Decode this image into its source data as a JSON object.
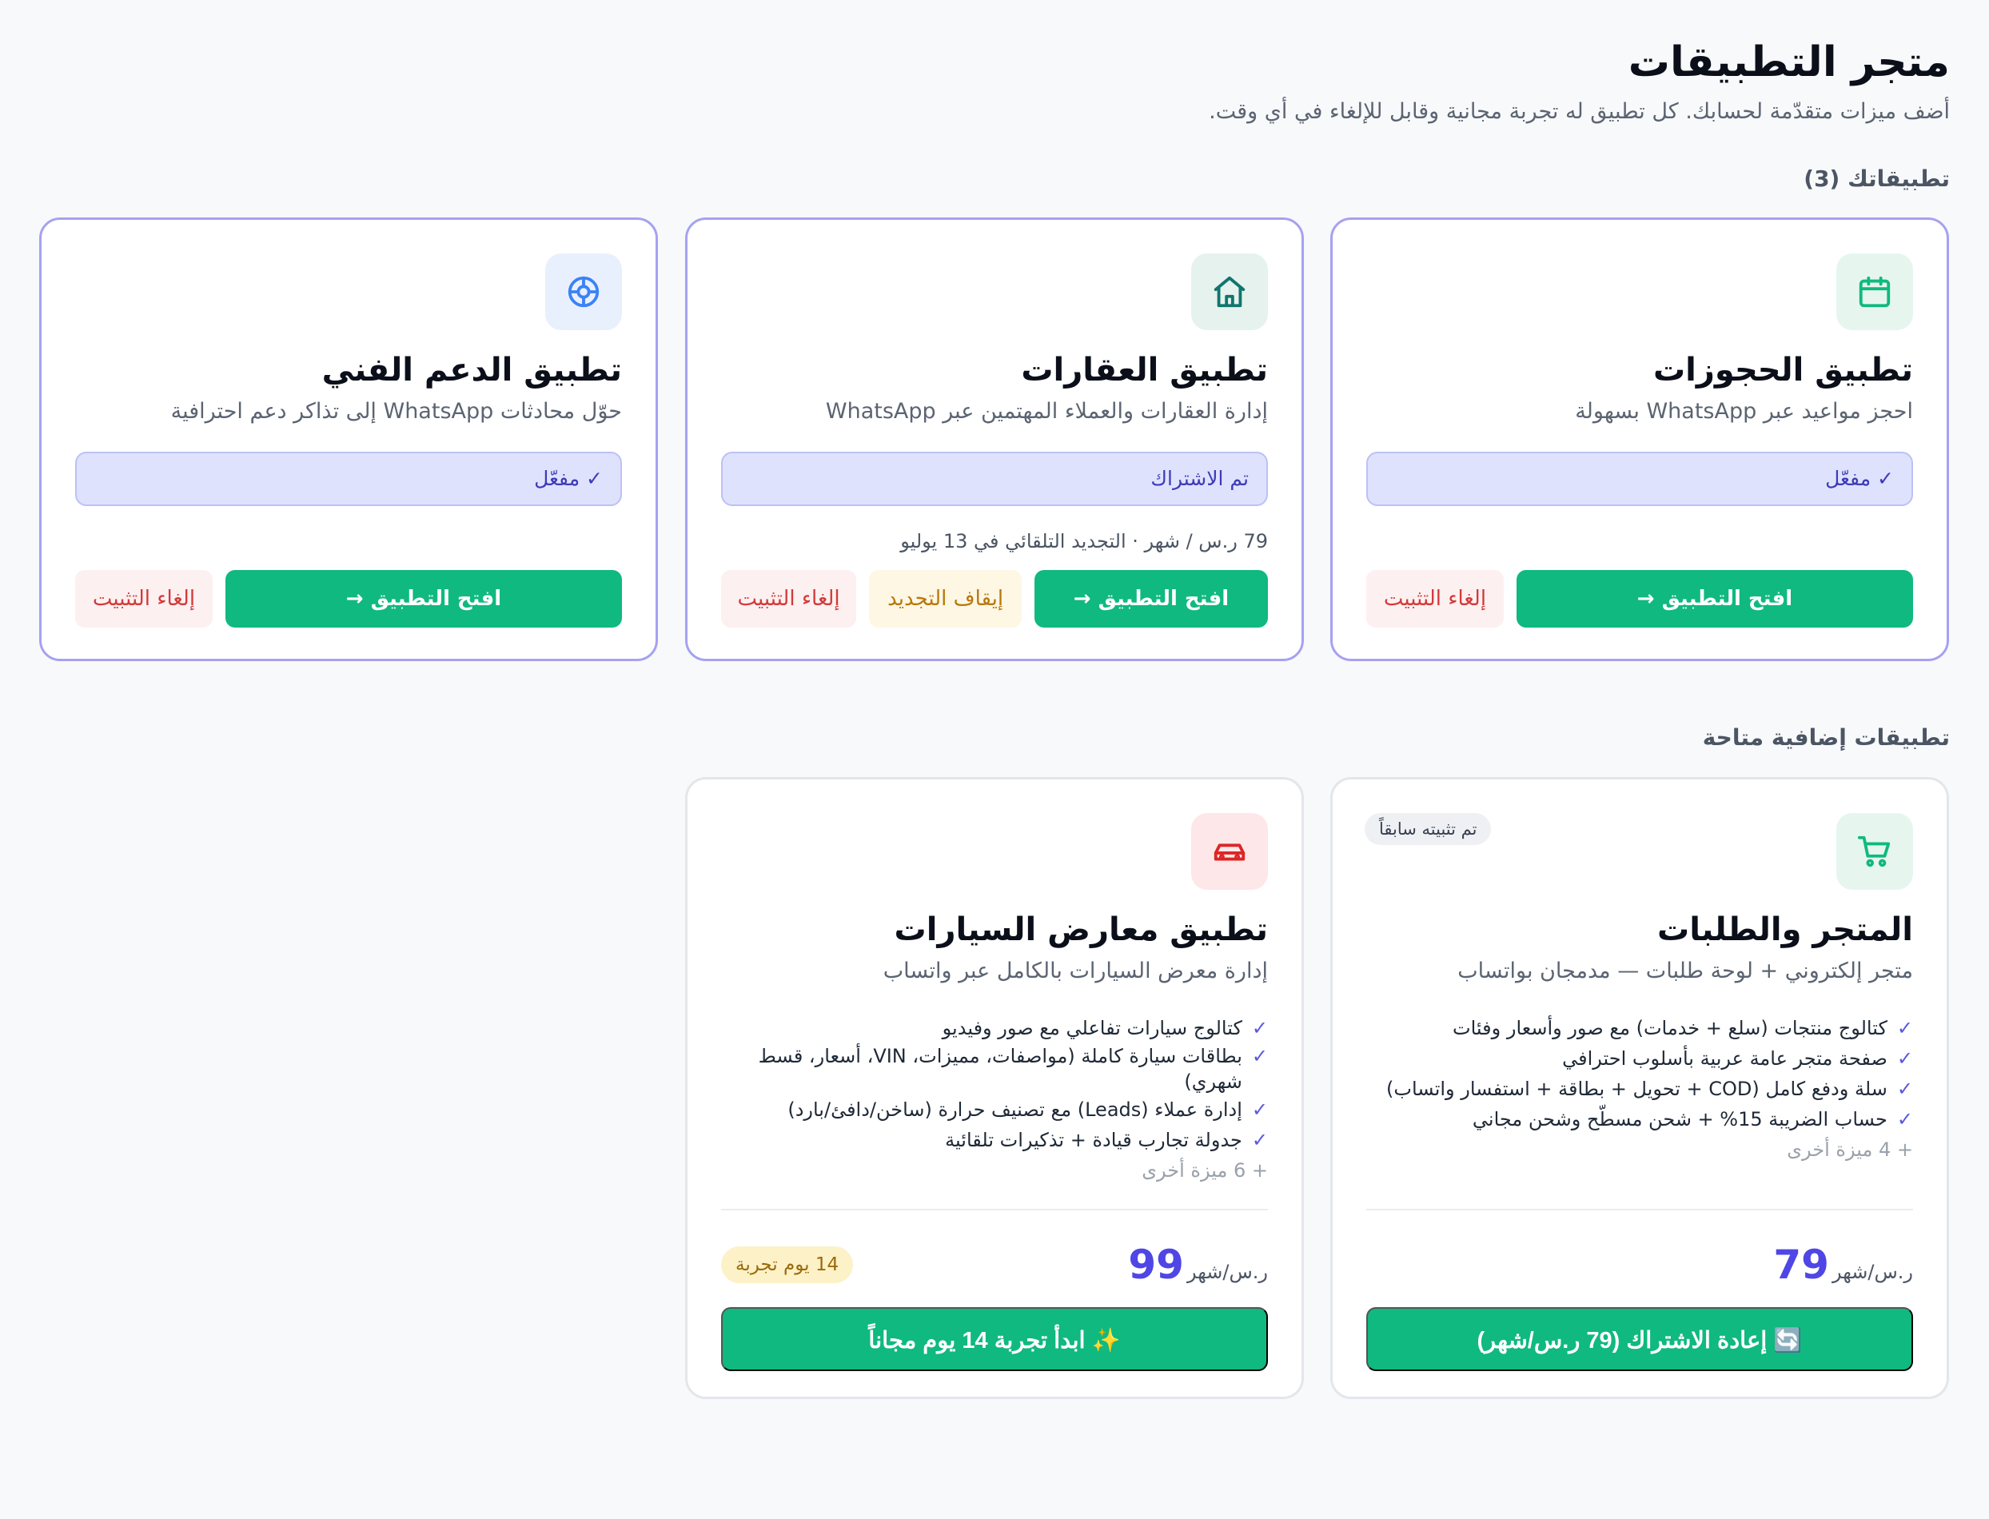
{
  "header": {
    "title": "متجر التطبيقات",
    "subtitle": "أضف ميزات متقدّمة لحسابك. كل تطبيق له تجربة مجانية وقابل للإلغاء في أي وقت."
  },
  "installed_section": {
    "title": "تطبيقاتك (3)",
    "apps": [
      {
        "icon": "calendar-icon",
        "title": "تطبيق الحجوزات",
        "description": "احجز مواعيد عبر WhatsApp بسهولة",
        "status": "✓ مفعّل",
        "open_label": "افتح التطبيق →",
        "uninstall_label": "إلغاء التثبيت"
      },
      {
        "icon": "home-icon",
        "title": "تطبيق العقارات",
        "description": "إدارة العقارات والعملاء المهتمين عبر WhatsApp",
        "status": "تم الاشتراك",
        "renewal": "79 ر.س / شهر · التجديد التلقائي في 13 يوليو",
        "open_label": "افتح التطبيق →",
        "pause_label": "إيقاف التجديد",
        "uninstall_label": "إلغاء التثبيت"
      },
      {
        "icon": "support-lifebuoy-icon",
        "title": "تطبيق الدعم الفني",
        "description": "حوّل محادثات WhatsApp إلى تذاكر دعم احترافية",
        "status": "✓ مفعّل",
        "open_label": "افتح التطبيق →",
        "uninstall_label": "إلغاء التثبيت"
      }
    ]
  },
  "available_section": {
    "title": "تطبيقات إضافية متاحة",
    "apps": [
      {
        "icon": "shopping-cart-icon",
        "badge": "تم تثبيته سابقاً",
        "title": "المتجر والطلبات",
        "description": "متجر إلكتروني + لوحة طلبات — مدمجان بواتساب",
        "features": [
          "كتالوج منتجات (سلع + خدمات) مع صور وأسعار وفئات",
          "صفحة متجر عامة عربية بأسلوب احترافي",
          "سلة ودفع كامل (COD + تحويل + بطاقة + استفسار واتساب)",
          "حساب الضريبة 15% + شحن مسطّح وشحن مجاني"
        ],
        "more": "+ 4 ميزة أخرى",
        "price": "79",
        "price_unit": "ر.س/شهر",
        "cta": "🔄 إعادة الاشتراك (79 ر.س/شهر)"
      },
      {
        "icon": "car-icon",
        "title": "تطبيق معارض السيارات",
        "description": "إدارة معرض السيارات بالكامل عبر واتساب",
        "features": [
          "كتالوج سيارات تفاعلي مع صور وفيديو",
          "بطاقات سيارة كاملة (مواصفات، مميزات، VIN، أسعار، قسط شهري)",
          "إدارة عملاء (Leads) مع تصنيف حرارة (ساخن/دافئ/بارد)",
          "جدولة تجارب قيادة + تذكيرات تلقائية"
        ],
        "more": "+ 6 ميزة أخرى",
        "price": "99",
        "price_unit": "ر.س/شهر",
        "trial_badge": "14 يوم تجربة",
        "cta": "✨ ابدأ تجربة 14 يوم مجاناً"
      }
    ]
  },
  "colors": {
    "accent": "#4f46e5",
    "primary_button": "#10b97f",
    "installed_border": "#a5a2f1",
    "status_bg": "#dfe2fd",
    "danger": "#d23a3a",
    "warning": "#b9780a"
  }
}
